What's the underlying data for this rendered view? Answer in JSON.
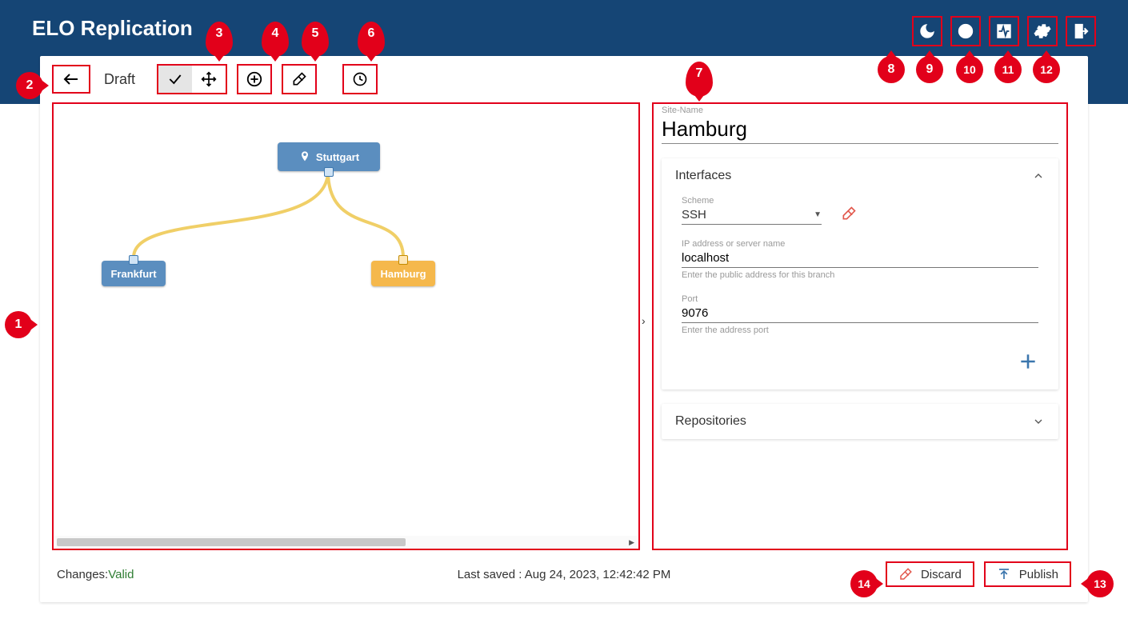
{
  "header": {
    "title": "ELO Replication"
  },
  "toolbar": {
    "draft_label": "Draft"
  },
  "graph": {
    "nodes": {
      "root": "Stuttgart",
      "left": "Frankfurt",
      "right": "Hamburg"
    }
  },
  "config": {
    "site_name_label": "Site-Name",
    "site_name_value": "Hamburg",
    "sections": {
      "interfaces_title": "Interfaces",
      "repositories_title": "Repositories"
    },
    "scheme": {
      "label": "Scheme",
      "value": "SSH"
    },
    "ip": {
      "label": "IP address or server name",
      "value": "localhost",
      "help": "Enter the public address for this branch"
    },
    "port": {
      "label": "Port",
      "value": "9076",
      "help": "Enter the address port"
    }
  },
  "footer": {
    "changes_label": "Changes: ",
    "changes_value": "Valid",
    "last_saved": "Last saved : Aug 24, 2023, 12:42:42 PM",
    "discard_label": "Discard",
    "publish_label": "Publish"
  },
  "notes": {
    "n1": "1",
    "n2": "2",
    "n3": "3",
    "n4": "4",
    "n5": "5",
    "n6": "6",
    "n7": "7",
    "n8": "8",
    "n9": "9",
    "n10": "10",
    "n11": "11",
    "n12": "12",
    "n13": "13",
    "n14": "14"
  }
}
